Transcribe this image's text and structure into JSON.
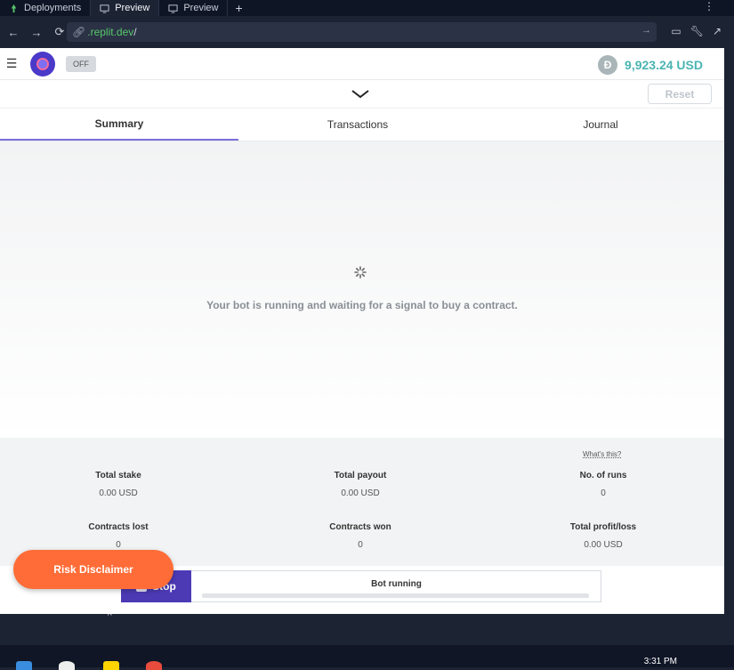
{
  "browser": {
    "tabs": [
      {
        "label": "Deployments",
        "icon": "deploy-icon"
      },
      {
        "label": "Preview",
        "icon": "monitor-icon"
      },
      {
        "label": "Preview",
        "icon": "monitor-icon"
      }
    ],
    "new_tab": "+",
    "url_host": ".replit.dev",
    "url_path": "/"
  },
  "app": {
    "toggle_label": "OFF",
    "balance": "9,923.24 USD",
    "reset_label": "Reset",
    "panel_tabs": [
      "Summary",
      "Transactions",
      "Journal"
    ],
    "status_message": "Your bot is running and waiting for a signal to buy a contract.",
    "whats_this": "What's this?",
    "stats": [
      {
        "label": "Total stake",
        "value": "0.00 USD"
      },
      {
        "label": "Total payout",
        "value": "0.00 USD"
      },
      {
        "label": "No. of runs",
        "value": "0"
      },
      {
        "label": "Contracts lost",
        "value": "0"
      },
      {
        "label": "Contracts won",
        "value": "0"
      },
      {
        "label": "Total profit/loss",
        "value": "0.00 USD"
      }
    ],
    "stop_label": "Stop",
    "bot_status": "Bot running",
    "risk_button": "Risk Disclaimer"
  },
  "colors": {
    "accent": "#4c3ab5",
    "balance": "#4bb4b3",
    "risk": "#ff6c37",
    "url": "#58c76b"
  },
  "taskbar": {
    "clock": "3:31 PM"
  }
}
